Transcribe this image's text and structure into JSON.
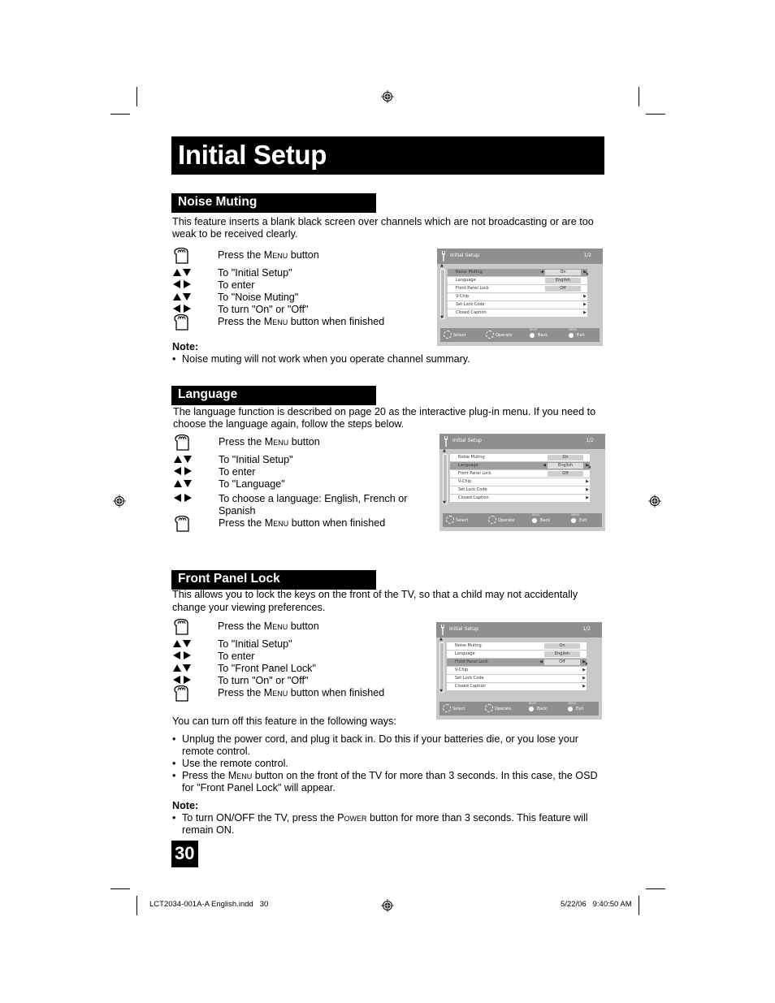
{
  "page": {
    "title": "Initial Setup",
    "page_number": "30",
    "slug_left": "LCT2034-001A-A English.indd   30",
    "slug_right": "5/22/06   9:40:50 AM"
  },
  "noise_muting": {
    "heading": "Noise Muting",
    "intro_line1": "This feature inserts a blank black screen over channels which are not broadcasting or are too",
    "intro_line2": "weak to be received clearly.",
    "steps": [
      {
        "icon": "hand-icon",
        "pre": "Press the ",
        "key": "Menu",
        "post": " button"
      },
      {
        "icon": "up-down-arrows-icon",
        "text": "To \"Initial Setup\""
      },
      {
        "icon": "left-right-arrows-icon",
        "text": "To enter"
      },
      {
        "icon": "up-down-arrows-icon",
        "text": "To \"Noise Muting\""
      },
      {
        "icon": "left-right-arrows-icon",
        "text": "To turn \"On\" or \"Off\""
      },
      {
        "icon": "hand-icon",
        "pre": "Press the ",
        "key": "Menu",
        "post": " button when finished"
      }
    ],
    "note_title": "Note:",
    "note": "Noise muting will not work when you operate channel summary."
  },
  "language": {
    "heading": "Language",
    "intro_line1": "The language function is described on page 20 as the interactive plug-in menu.  If you need to",
    "intro_line2": "choose the language again, follow the steps below.",
    "steps": [
      {
        "icon": "hand-icon",
        "pre": "Press the ",
        "key": "Menu",
        "post": " button"
      },
      {
        "icon": "up-down-arrows-icon",
        "text": "To \"Initial Setup\""
      },
      {
        "icon": "left-right-arrows-icon",
        "text": "To enter"
      },
      {
        "icon": "up-down-arrows-icon",
        "text": "To \"Language\""
      },
      {
        "icon": "left-right-arrows-icon",
        "text": "To choose a language: English, French or",
        "text2": "Spanish"
      },
      {
        "icon": "hand-icon",
        "pre": "Press the ",
        "key": "Menu",
        "post": " button when finished"
      }
    ]
  },
  "front_panel_lock": {
    "heading": "Front Panel Lock",
    "intro_line1": "This allows you to lock the keys on the front of the TV, so that a child may not accidentally",
    "intro_line2": "change your viewing preferences.",
    "steps": [
      {
        "icon": "hand-icon",
        "pre": "Press the ",
        "key": "Menu",
        "post": " button"
      },
      {
        "icon": "up-down-arrows-icon",
        "text": "To \"Initial Setup\""
      },
      {
        "icon": "left-right-arrows-icon",
        "text": "To enter"
      },
      {
        "icon": "up-down-arrows-icon",
        "text": "To \"Front Panel Lock\""
      },
      {
        "icon": "left-right-arrows-icon",
        "text": "To turn \"On\" or \"Off\""
      },
      {
        "icon": "hand-icon",
        "pre": "Press the ",
        "key": "Menu",
        "post": " button when finished"
      }
    ],
    "ways_intro": "You can turn off this feature in the following ways:",
    "ways": [
      {
        "line1": "Unplug the power cord, and plug it back in. Do this if your batteries die, or you lose your",
        "line2": "remote control."
      },
      {
        "line1": "Use the remote control."
      },
      {
        "pre": "Press the ",
        "key": "Menu",
        "post": " button on the front of the TV for more than 3 seconds. In this case, the OSD",
        "line2": "for \"Front Panel Lock\" will appear."
      }
    ],
    "note_title": "Note:",
    "note_pre": "To turn ON/OFF the TV, press the ",
    "note_key": "Power",
    "note_post": " button for more than 3 seconds. This feature will",
    "note_line2": "remain ON."
  },
  "osd": {
    "title": "Initial Setup",
    "page": "1/2",
    "items": [
      {
        "label": "Noise Muting",
        "value": "On"
      },
      {
        "label": "Language",
        "value": "English"
      },
      {
        "label": "Front Panel Lock",
        "value": "Off"
      },
      {
        "label": "V-Chip",
        "value": ""
      },
      {
        "label": "Set Lock Code",
        "value": ""
      },
      {
        "label": "Closed Caption",
        "value": ""
      }
    ],
    "footer": {
      "select": "Select",
      "operate": "Operate",
      "back_caption": "BACK",
      "back": "Back",
      "exit_caption": "MENU",
      "exit": "Exit"
    },
    "screens": [
      {
        "section": "noise_muting",
        "selected_index": 0
      },
      {
        "section": "language",
        "selected_index": 1
      },
      {
        "section": "front_panel_lock",
        "selected_index": 2
      }
    ]
  }
}
